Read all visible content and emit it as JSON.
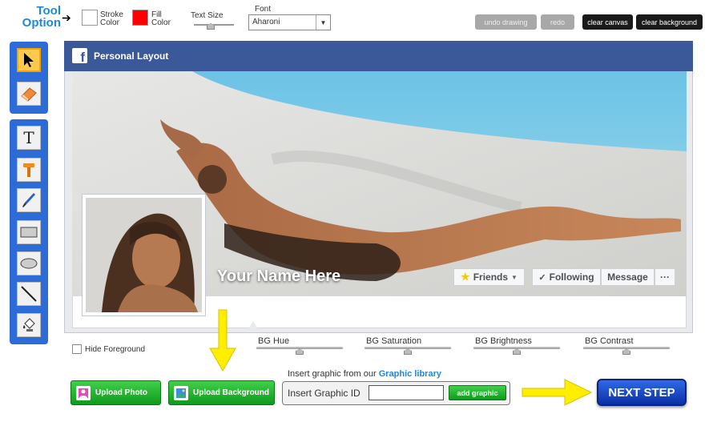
{
  "toolbar": {
    "title_line1": "Tool",
    "title_line2": "Option",
    "stroke_color_label_1": "Stroke",
    "stroke_color_label_2": "Color",
    "stroke_color": "#ffffff",
    "fill_color_label_1": "Fill",
    "fill_color_label_2": "Color",
    "fill_color": "#ff0000",
    "text_size_label": "Text Size",
    "font_label": "Font",
    "font_value": "Aharoni",
    "undo_label": "undo drawing",
    "redo_label": "redo",
    "clear_canvas_label": "clear canvas",
    "clear_background_label": "clear background"
  },
  "tools": {
    "group1": [
      "pointer-icon",
      "eraser-icon"
    ],
    "group2": [
      "text-icon",
      "hammer-icon",
      "brush-icon",
      "rectangle-icon",
      "ellipse-icon",
      "line-icon",
      "paint-bucket-icon"
    ],
    "active": "pointer-icon"
  },
  "facebook": {
    "title": "Personal Layout",
    "logo_letter": "f",
    "name_placeholder": "Your Name Here",
    "friends_label": "Friends",
    "following_label": "Following",
    "message_label": "Message",
    "more_label": "···"
  },
  "adjustments": {
    "hide_foreground_label": "Hide Foreground",
    "bg_hue_label": "BG Hue",
    "bg_saturation_label": "BG Saturation",
    "bg_brightness_label": "BG Brightness",
    "bg_contrast_label": "BG Contrast"
  },
  "bottom": {
    "upload_photo_label": "Upload  Photo",
    "upload_background_label": "Upload Background",
    "insert_caption_prefix": "Insert graphic from our ",
    "graphic_library_label": "Graphic library",
    "insert_graphic_id_label": "Insert Graphic ID",
    "insert_graphic_id_value": "",
    "add_graphic_label": "add graphic",
    "next_step_label": "NEXT STEP"
  },
  "colors": {
    "accent_blue": "#2d6cd6",
    "facebook_blue": "#3b5998",
    "green": "#19b026",
    "arrow_yellow": "#ffee00"
  }
}
